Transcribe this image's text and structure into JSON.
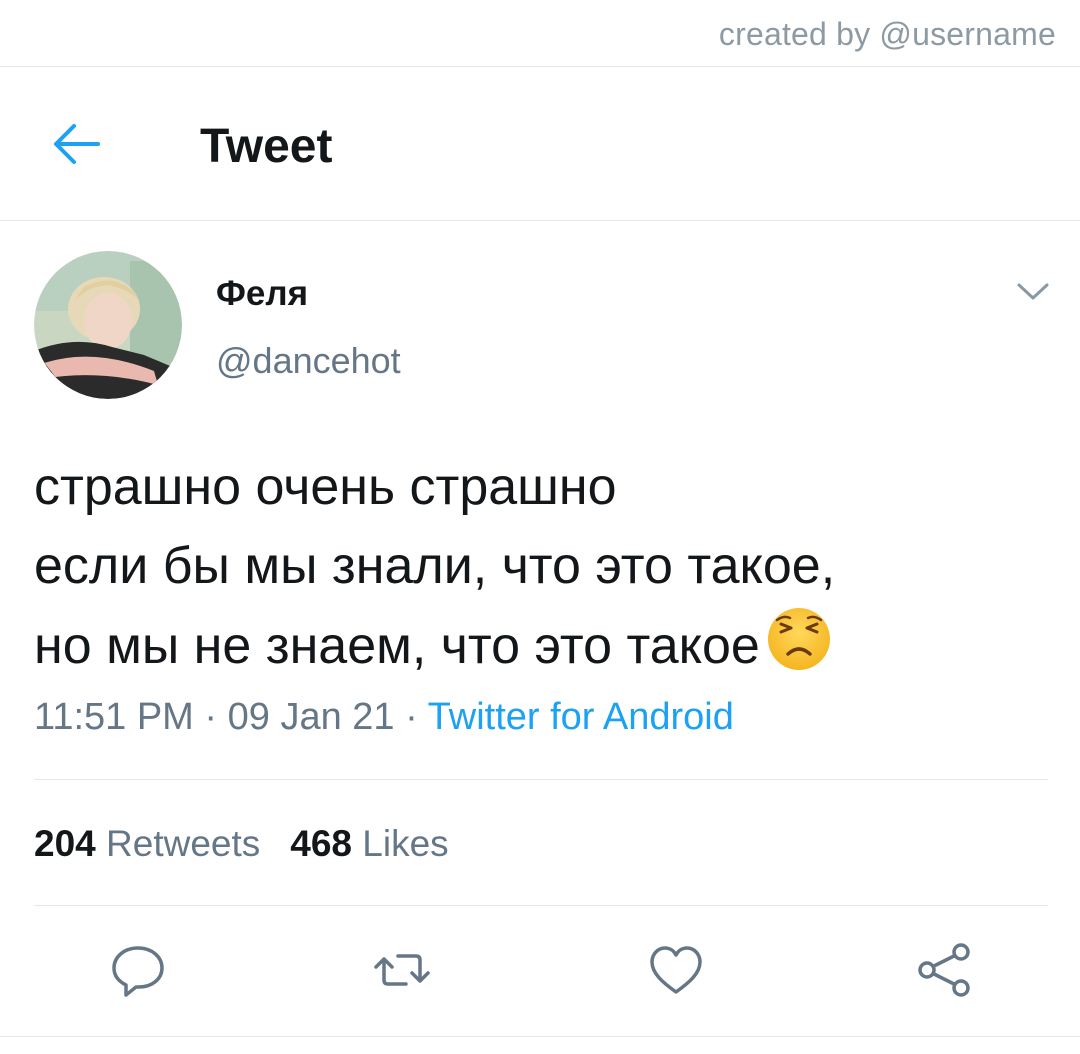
{
  "watermark": {
    "text": "created by @username"
  },
  "header": {
    "title": "Tweet",
    "back_icon": "arrow-left-icon"
  },
  "tweet": {
    "display_name": "Феля",
    "handle": "@dancehot",
    "text_lines": [
      "страшно очень страшно",
      "если бы мы знали, что это такое,",
      "но мы не знаем, что это такое"
    ],
    "emoji": "persevering-face-emoji",
    "time": "11:51 PM",
    "separator": "·",
    "date": "09 Jan 21",
    "source": "Twitter for Android",
    "retweets_count": "204",
    "retweets_label": "Retweets",
    "likes_count": "468",
    "likes_label": "Likes"
  },
  "actions": [
    "reply-icon",
    "retweet-icon",
    "like-icon",
    "share-icon"
  ],
  "colors": {
    "accent": "#1da1f2",
    "text_primary": "#14171a",
    "text_secondary": "#657786",
    "divider": "#e1e8ed"
  }
}
